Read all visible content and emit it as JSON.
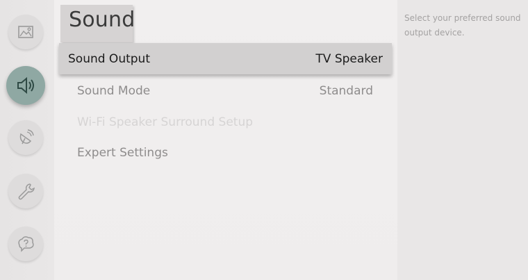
{
  "page": {
    "title": "Sound"
  },
  "sidebar": {
    "items": [
      {
        "icon": "picture-icon",
        "selected": false
      },
      {
        "icon": "speaker-icon",
        "selected": true
      },
      {
        "icon": "broadcast-icon",
        "selected": false
      },
      {
        "icon": "wrench-icon",
        "selected": false
      },
      {
        "icon": "support-icon",
        "selected": false
      }
    ]
  },
  "menu": {
    "items": [
      {
        "label": "Sound Output",
        "value": "TV Speaker",
        "state": "focused"
      },
      {
        "label": "Sound Mode",
        "value": "Standard",
        "state": "normal"
      },
      {
        "label": "Wi-Fi Speaker Surround Setup",
        "value": "",
        "state": "disabled"
      },
      {
        "label": "Expert Settings",
        "value": "",
        "state": "normal"
      }
    ]
  },
  "description": {
    "text": "Select your preferred sound output device."
  },
  "colors": {
    "selected_icon_bg": "#8fa8a3",
    "icon_stroke": "#9a9a9a",
    "selected_icon_stroke": "#2f4a45",
    "focused_row_bg": "#d2d0d0"
  }
}
